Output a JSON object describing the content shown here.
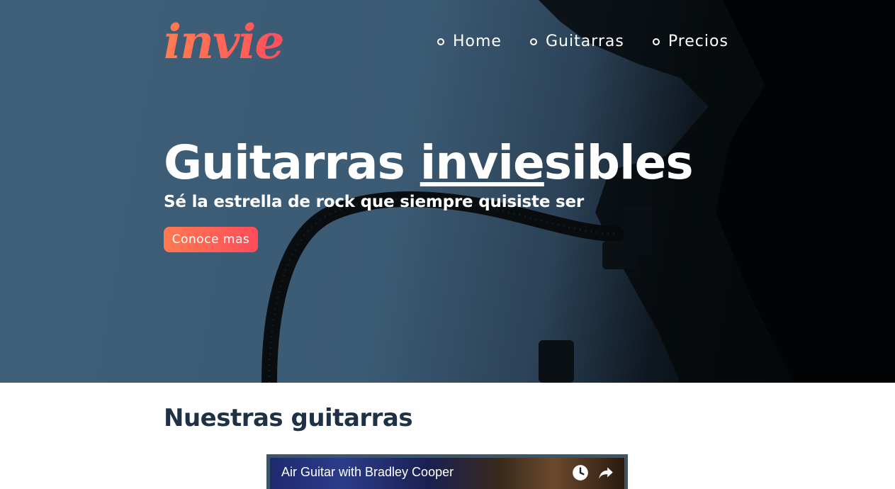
{
  "brand": {
    "logo_text": "invie",
    "colors": {
      "accent_start": "#ff7e4f",
      "accent_end": "#ff4e5e",
      "dark_text": "#1f3245",
      "hero_blue": "#3d5c75"
    }
  },
  "nav": {
    "items": [
      {
        "label": "Home",
        "icon": "circle-bullet-icon"
      },
      {
        "label": "Guitarras",
        "icon": "circle-bullet-icon"
      },
      {
        "label": "Precios",
        "icon": "circle-bullet-icon"
      }
    ]
  },
  "hero": {
    "title_prefix": "Guitarras ",
    "title_highlight": "invie",
    "title_suffix": "sibles",
    "subtitle": "Sé la estrella de rock que siempre quisiste ser",
    "cta_label": "Conoce mas"
  },
  "guitars_section": {
    "title": "Nuestras guitarras",
    "video": {
      "title": "Air Guitar with Bradley Cooper",
      "icons": [
        "watch-later-icon",
        "share-icon"
      ]
    }
  }
}
